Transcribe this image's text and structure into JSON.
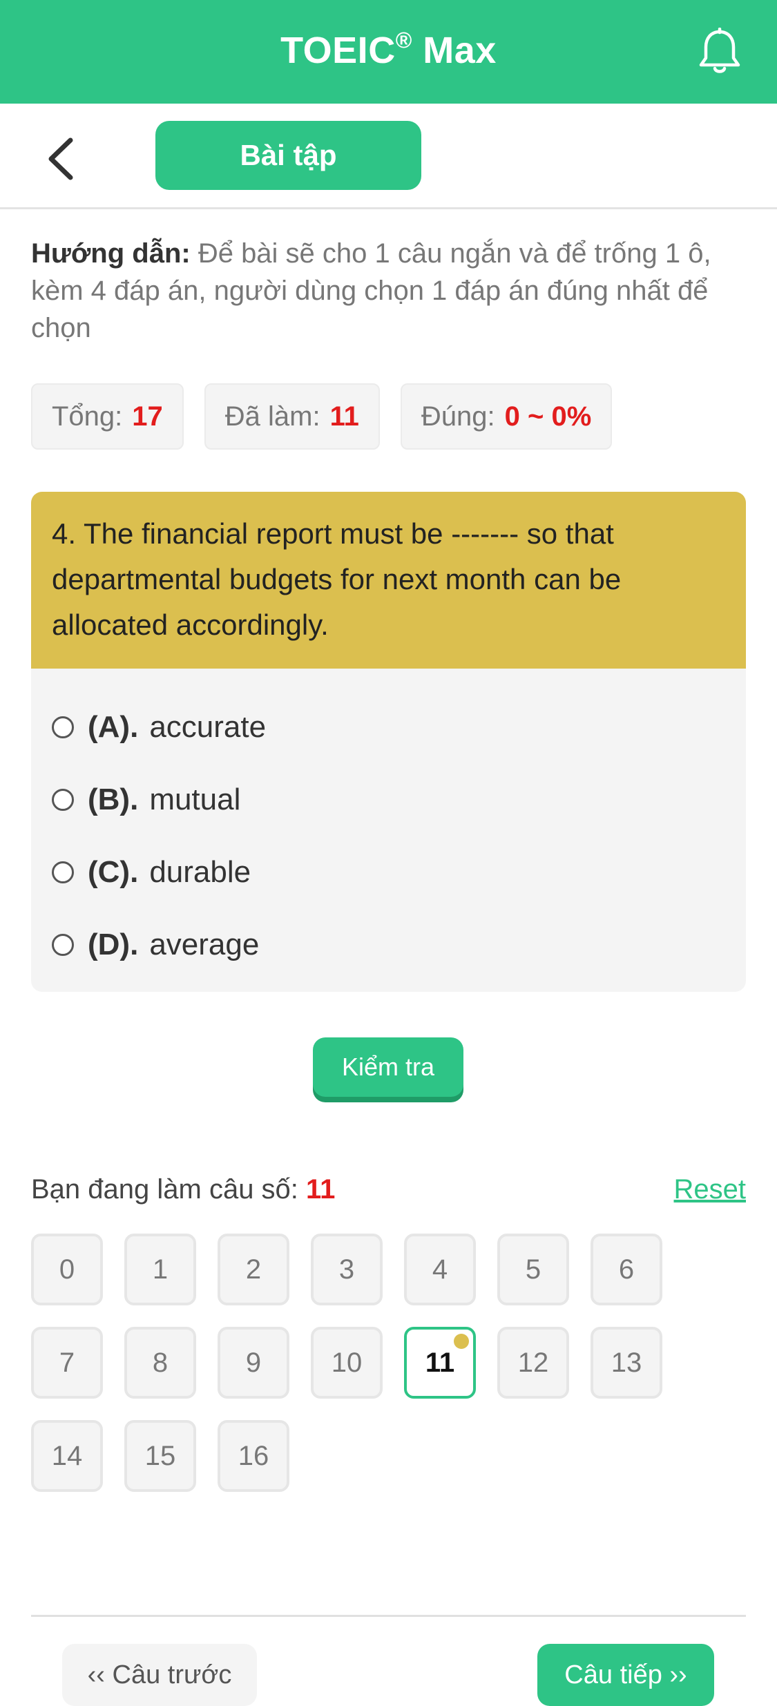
{
  "header": {
    "title": "TOEIC",
    "title_mark": "®",
    "title_suffix": " Max",
    "bell_icon": "bell-icon"
  },
  "subbar": {
    "back_icon": "chevron-left-icon",
    "tab_label": "Bài tập"
  },
  "guide": {
    "label": "Hướng dẫn:",
    "text": " Để bài sẽ cho 1 câu ngắn và để trống 1 ô, kèm 4 đáp án, người dùng chọn 1 đáp án đúng nhất để chọn"
  },
  "stats": [
    {
      "label": "Tổng:",
      "value": "17"
    },
    {
      "label": "Đã làm:",
      "value": "11"
    },
    {
      "label": "Đúng:",
      "value": "0 ~ 0%"
    }
  ],
  "question": {
    "text": "4. The financial report must be ------- so that departmental budgets for next month can be allocated accordingly.",
    "options": [
      {
        "letter": "(A).",
        "text": "accurate"
      },
      {
        "letter": "(B).",
        "text": "mutual"
      },
      {
        "letter": "(C).",
        "text": "durable"
      },
      {
        "letter": "(D).",
        "text": "average"
      }
    ]
  },
  "check_button": "Kiểm tra",
  "progress": {
    "label": "Bạn đang làm câu số: ",
    "current": "11",
    "reset_label": "Reset"
  },
  "grid_numbers": [
    "0",
    "1",
    "2",
    "3",
    "4",
    "5",
    "6",
    "7",
    "8",
    "9",
    "10",
    "11",
    "12",
    "13",
    "14",
    "15",
    "16"
  ],
  "active_number": "11",
  "nav": {
    "prev_label": "‹‹ Câu trước",
    "next_label": "Câu tiếp ››"
  },
  "colors": {
    "brand": "#2ec486",
    "question_bg": "#dbbf4f",
    "highlight": "#e21d1d"
  }
}
